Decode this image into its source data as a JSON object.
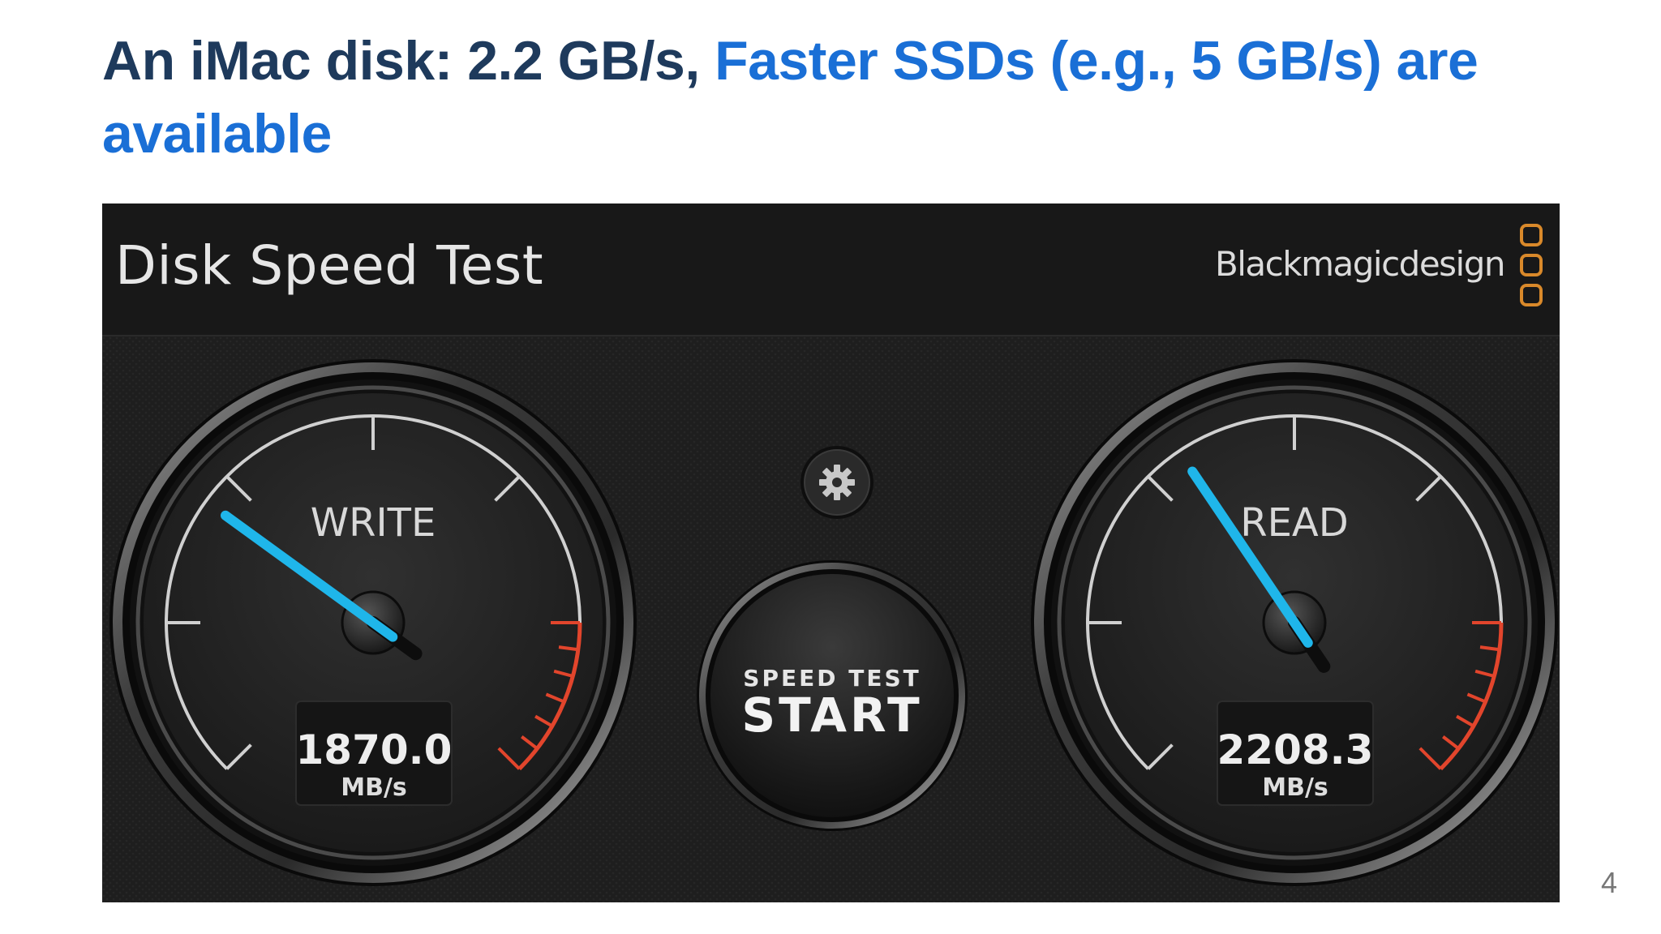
{
  "slide": {
    "title_part1": "An iMac disk: 2.2 GB/s, ",
    "title_part2": "Faster SSDs (e.g., 5 GB/s) are available",
    "page_number": "4"
  },
  "app": {
    "title": "Disk Speed Test",
    "brand": "Blackmagicdesign",
    "settings_icon": "gear-icon",
    "start_button": {
      "line1": "SPEED TEST",
      "line2": "START"
    }
  },
  "gauges": {
    "write": {
      "label": "WRITE",
      "value": "1870.0",
      "unit": "MB/s",
      "needle_angle_deg": -54
    },
    "read": {
      "label": "READ",
      "value": "2208.3",
      "unit": "MB/s",
      "needle_angle_deg": -34
    }
  },
  "colors": {
    "title_dark": "#1e3a5c",
    "title_blue": "#1a6fd6",
    "needle": "#1fb6ea",
    "redline": "#e2452c",
    "brand_logo": "#d9892a"
  }
}
